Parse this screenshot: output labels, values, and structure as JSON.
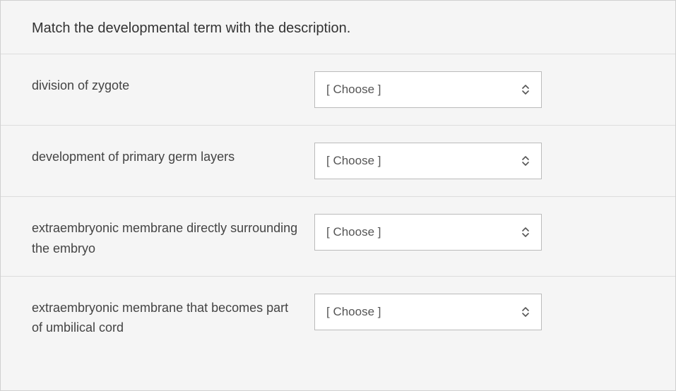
{
  "question": {
    "prompt": "Match the developmental term with the description."
  },
  "placeholder": "[ Choose ]",
  "items": [
    {
      "description": "division of zygote"
    },
    {
      "description": "development of primary germ layers"
    },
    {
      "description": "extraembryonic membrane directly surrounding the embryo"
    },
    {
      "description": "extraembryonic membrane that becomes part of umbilical cord"
    }
  ]
}
